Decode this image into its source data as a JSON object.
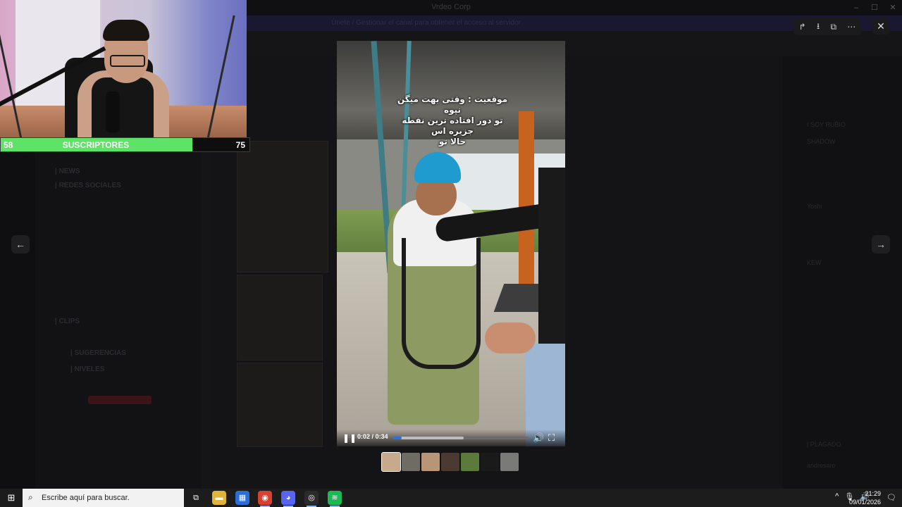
{
  "app": {
    "title": "Vrdeo Corp",
    "banner": "Únete / Gestionar el canal para obtener el acceso al servidor",
    "window_controls": [
      "–",
      "☐",
      "✕"
    ]
  },
  "background": {
    "channels": [
      "| NEWS",
      "| REDES SOCIALES",
      "| CLIPS",
      "| SUGERENCIAS",
      "| NIVELES"
    ],
    "members": [
      "I SOY RUBIO",
      "SHADOW",
      "Yoshi",
      "KEW",
      "| PLAGADO",
      "andresaro"
    ]
  },
  "webcam": {
    "subs_current": "58",
    "subs_label": "SUSCRIPTORES",
    "subs_goal": "75",
    "progress_fraction": 0.77
  },
  "viewer": {
    "toolbar_icons": [
      "share-icon",
      "download-icon",
      "open-external-icon",
      "more-icon"
    ],
    "toolbar_glyphs": [
      "↱",
      "⭳",
      "⧉",
      "⋯"
    ],
    "close_glyph": "✕",
    "prev_glyph": "←",
    "next_glyph": "→",
    "video": {
      "caption_lines": [
        "موقعیت : وقتی بهت میگن",
        "نپوه",
        "تو دور افتاده ترین نقطه",
        "جزیره اس",
        "حالا تو"
      ],
      "current_time": "0:02",
      "duration": "0:34",
      "time_display": "0:02 / 0:34",
      "played_fraction": 0.06,
      "buffered_fraction": 0.52,
      "pause_glyph": "❚❚",
      "volume_glyph": "🔊",
      "fullscreen_glyph": "⛶"
    },
    "thumbnail_colors": [
      "#c9a98c",
      "#6f6c66",
      "#b99578",
      "#4a3a30",
      "#5c7a3a",
      "#1a1a1a",
      "#7a7a78"
    ]
  },
  "taskbar": {
    "start_glyph": "⊞",
    "search_placeholder": "Escribe aquí para buscar.",
    "search_glyph": "⌕",
    "apps": [
      {
        "name": "task-view",
        "glyph": "⧉",
        "color": "#1c1c1c"
      },
      {
        "name": "file-explorer",
        "glyph": "▬",
        "color": "#e0b43a"
      },
      {
        "name": "store",
        "glyph": "▦",
        "color": "#2b6fd6"
      },
      {
        "name": "chrome",
        "glyph": "◉",
        "color": "#d8402f"
      },
      {
        "name": "discord",
        "glyph": "◕",
        "color": "#5865f2"
      },
      {
        "name": "obs",
        "glyph": "◎",
        "color": "#2b2b2b"
      },
      {
        "name": "spotify",
        "glyph": "≋",
        "color": "#1db954"
      }
    ],
    "tray_glyphs": [
      "^",
      "🎙",
      "🔊"
    ],
    "time": "21:29",
    "date": "09/01/2026",
    "notif_glyph": "🗨"
  }
}
